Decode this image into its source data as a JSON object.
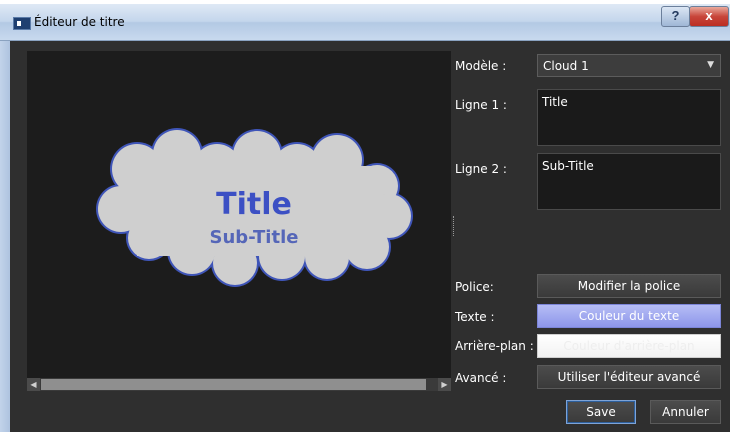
{
  "window": {
    "title": "Éditeur de titre",
    "help_label": "?",
    "close_label": "x"
  },
  "preview": {
    "title_text": "Title",
    "subtitle_text": "Sub-Title",
    "cloud_fill": "#cfcfcf",
    "cloud_outline": "#3f55b8",
    "title_color": "#3c50c4",
    "subtitle_color": "#5566b8"
  },
  "form": {
    "model_label": "Modèle :",
    "model_value": "Cloud 1",
    "line1_label": "Ligne 1 :",
    "line1_value": "Title",
    "line2_label": "Ligne 2 :",
    "line2_value": "Sub-Title",
    "font_label": "Police:",
    "font_button": "Modifier la police",
    "text_label": "Texte :",
    "text_color_button": "Couleur du texte",
    "bg_label": "Arrière-plan :",
    "bg_color_button": "Couleur d'arrière-plan",
    "advanced_label": "Avancé :",
    "advanced_button": "Utiliser l'éditeur avancé"
  },
  "footer": {
    "save_label": "Save",
    "cancel_label": "Annuler"
  }
}
